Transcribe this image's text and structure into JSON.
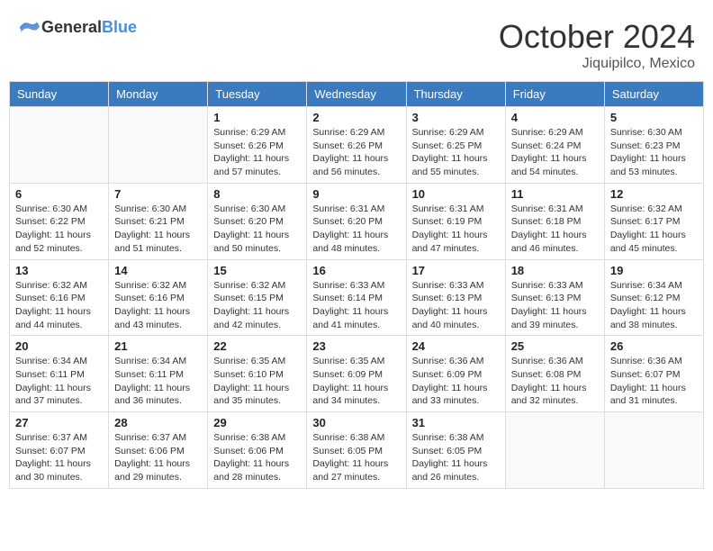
{
  "header": {
    "logo_general": "General",
    "logo_blue": "Blue",
    "month": "October 2024",
    "location": "Jiquipilco, Mexico"
  },
  "weekdays": [
    "Sunday",
    "Monday",
    "Tuesday",
    "Wednesday",
    "Thursday",
    "Friday",
    "Saturday"
  ],
  "weeks": [
    [
      {
        "day": "",
        "info": ""
      },
      {
        "day": "",
        "info": ""
      },
      {
        "day": "1",
        "info": "Sunrise: 6:29 AM\nSunset: 6:26 PM\nDaylight: 11 hours and 57 minutes."
      },
      {
        "day": "2",
        "info": "Sunrise: 6:29 AM\nSunset: 6:26 PM\nDaylight: 11 hours and 56 minutes."
      },
      {
        "day": "3",
        "info": "Sunrise: 6:29 AM\nSunset: 6:25 PM\nDaylight: 11 hours and 55 minutes."
      },
      {
        "day": "4",
        "info": "Sunrise: 6:29 AM\nSunset: 6:24 PM\nDaylight: 11 hours and 54 minutes."
      },
      {
        "day": "5",
        "info": "Sunrise: 6:30 AM\nSunset: 6:23 PM\nDaylight: 11 hours and 53 minutes."
      }
    ],
    [
      {
        "day": "6",
        "info": "Sunrise: 6:30 AM\nSunset: 6:22 PM\nDaylight: 11 hours and 52 minutes."
      },
      {
        "day": "7",
        "info": "Sunrise: 6:30 AM\nSunset: 6:21 PM\nDaylight: 11 hours and 51 minutes."
      },
      {
        "day": "8",
        "info": "Sunrise: 6:30 AM\nSunset: 6:20 PM\nDaylight: 11 hours and 50 minutes."
      },
      {
        "day": "9",
        "info": "Sunrise: 6:31 AM\nSunset: 6:20 PM\nDaylight: 11 hours and 48 minutes."
      },
      {
        "day": "10",
        "info": "Sunrise: 6:31 AM\nSunset: 6:19 PM\nDaylight: 11 hours and 47 minutes."
      },
      {
        "day": "11",
        "info": "Sunrise: 6:31 AM\nSunset: 6:18 PM\nDaylight: 11 hours and 46 minutes."
      },
      {
        "day": "12",
        "info": "Sunrise: 6:32 AM\nSunset: 6:17 PM\nDaylight: 11 hours and 45 minutes."
      }
    ],
    [
      {
        "day": "13",
        "info": "Sunrise: 6:32 AM\nSunset: 6:16 PM\nDaylight: 11 hours and 44 minutes."
      },
      {
        "day": "14",
        "info": "Sunrise: 6:32 AM\nSunset: 6:16 PM\nDaylight: 11 hours and 43 minutes."
      },
      {
        "day": "15",
        "info": "Sunrise: 6:32 AM\nSunset: 6:15 PM\nDaylight: 11 hours and 42 minutes."
      },
      {
        "day": "16",
        "info": "Sunrise: 6:33 AM\nSunset: 6:14 PM\nDaylight: 11 hours and 41 minutes."
      },
      {
        "day": "17",
        "info": "Sunrise: 6:33 AM\nSunset: 6:13 PM\nDaylight: 11 hours and 40 minutes."
      },
      {
        "day": "18",
        "info": "Sunrise: 6:33 AM\nSunset: 6:13 PM\nDaylight: 11 hours and 39 minutes."
      },
      {
        "day": "19",
        "info": "Sunrise: 6:34 AM\nSunset: 6:12 PM\nDaylight: 11 hours and 38 minutes."
      }
    ],
    [
      {
        "day": "20",
        "info": "Sunrise: 6:34 AM\nSunset: 6:11 PM\nDaylight: 11 hours and 37 minutes."
      },
      {
        "day": "21",
        "info": "Sunrise: 6:34 AM\nSunset: 6:11 PM\nDaylight: 11 hours and 36 minutes."
      },
      {
        "day": "22",
        "info": "Sunrise: 6:35 AM\nSunset: 6:10 PM\nDaylight: 11 hours and 35 minutes."
      },
      {
        "day": "23",
        "info": "Sunrise: 6:35 AM\nSunset: 6:09 PM\nDaylight: 11 hours and 34 minutes."
      },
      {
        "day": "24",
        "info": "Sunrise: 6:36 AM\nSunset: 6:09 PM\nDaylight: 11 hours and 33 minutes."
      },
      {
        "day": "25",
        "info": "Sunrise: 6:36 AM\nSunset: 6:08 PM\nDaylight: 11 hours and 32 minutes."
      },
      {
        "day": "26",
        "info": "Sunrise: 6:36 AM\nSunset: 6:07 PM\nDaylight: 11 hours and 31 minutes."
      }
    ],
    [
      {
        "day": "27",
        "info": "Sunrise: 6:37 AM\nSunset: 6:07 PM\nDaylight: 11 hours and 30 minutes."
      },
      {
        "day": "28",
        "info": "Sunrise: 6:37 AM\nSunset: 6:06 PM\nDaylight: 11 hours and 29 minutes."
      },
      {
        "day": "29",
        "info": "Sunrise: 6:38 AM\nSunset: 6:06 PM\nDaylight: 11 hours and 28 minutes."
      },
      {
        "day": "30",
        "info": "Sunrise: 6:38 AM\nSunset: 6:05 PM\nDaylight: 11 hours and 27 minutes."
      },
      {
        "day": "31",
        "info": "Sunrise: 6:38 AM\nSunset: 6:05 PM\nDaylight: 11 hours and 26 minutes."
      },
      {
        "day": "",
        "info": ""
      },
      {
        "day": "",
        "info": ""
      }
    ]
  ]
}
